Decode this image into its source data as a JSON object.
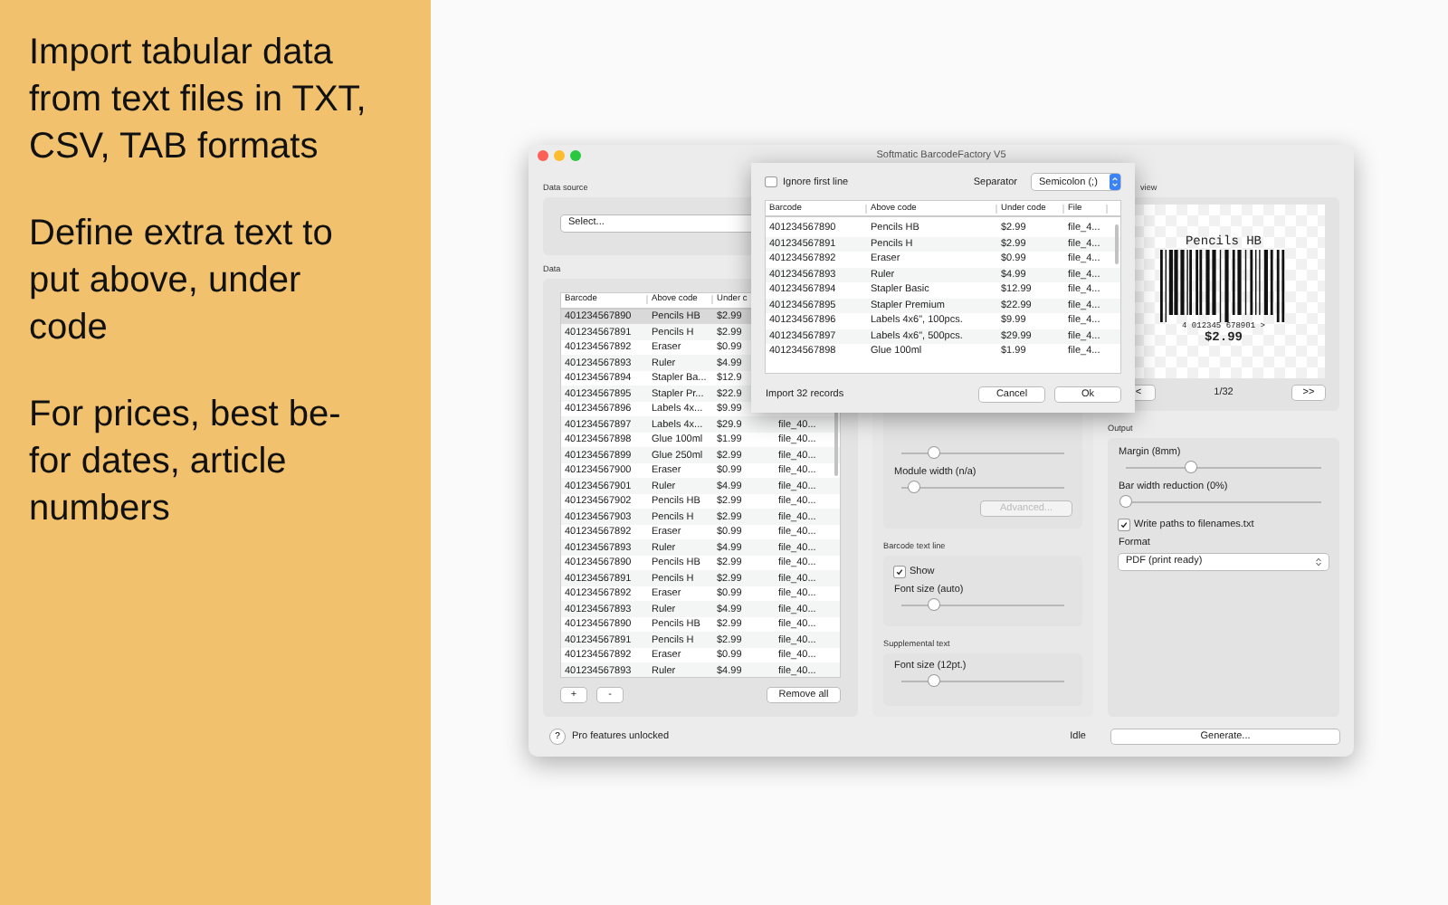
{
  "promo": {
    "paragraphs": [
      "Import tabular data from text files in TXT, CSV, TAB formats",
      "Define extra text to put above, under code",
      "For prices, best be-for dates, article numbers"
    ]
  },
  "window": {
    "title": "Softmatic BarcodeFactory V5"
  },
  "data_source": {
    "heading": "Data source",
    "select": "Select..."
  },
  "data": {
    "heading": "Data",
    "columns": [
      "Barcode",
      "Above code",
      "Under c"
    ],
    "rows": [
      {
        "barcode": "401234567890",
        "above": "Pencils HB",
        "under": "$2.99",
        "selected": true
      },
      {
        "barcode": "401234567891",
        "above": "Pencils H",
        "under": "$2.99",
        "selected": false
      },
      {
        "barcode": "401234567892",
        "above": "Eraser",
        "under": "$0.99",
        "selected": false
      },
      {
        "barcode": "401234567893",
        "above": "Ruler",
        "under": "$4.99",
        "selected": false
      },
      {
        "barcode": "401234567894",
        "above": "Stapler Ba...",
        "under": "$12.9",
        "selected": false
      },
      {
        "barcode": "401234567895",
        "above": "Stapler Pr...",
        "under": "$22.9",
        "selected": false
      },
      {
        "barcode": "401234567896",
        "above": "Labels 4x...",
        "under": "$9.99",
        "selected": false
      },
      {
        "barcode": "401234567897",
        "above": "Labels 4x...",
        "under": "$29.9",
        "file": "file_40...",
        "selected": false
      },
      {
        "barcode": "401234567898",
        "above": "Glue 100ml",
        "under": "$1.99",
        "file": "file_40...",
        "selected": false
      },
      {
        "barcode": "401234567899",
        "above": "Glue 250ml",
        "under": "$2.99",
        "file": "file_40...",
        "selected": false
      },
      {
        "barcode": "401234567900",
        "above": "Eraser",
        "under": "$0.99",
        "file": "file_40...",
        "selected": false
      },
      {
        "barcode": "401234567901",
        "above": "Ruler",
        "under": "$4.99",
        "file": "file_40...",
        "selected": false
      },
      {
        "barcode": "401234567902",
        "above": "Pencils HB",
        "under": "$2.99",
        "file": "file_40...",
        "selected": false
      },
      {
        "barcode": "401234567903",
        "above": "Pencils H",
        "under": "$2.99",
        "file": "file_40...",
        "selected": false
      },
      {
        "barcode": "401234567892",
        "above": "Eraser",
        "under": "$0.99",
        "file": "file_40...",
        "selected": false
      },
      {
        "barcode": "401234567893",
        "above": "Ruler",
        "under": "$4.99",
        "file": "file_40...",
        "selected": false
      },
      {
        "barcode": "401234567890",
        "above": "Pencils HB",
        "under": "$2.99",
        "file": "file_40...",
        "selected": false
      },
      {
        "barcode": "401234567891",
        "above": "Pencils H",
        "under": "$2.99",
        "file": "file_40...",
        "selected": false
      },
      {
        "barcode": "401234567892",
        "above": "Eraser",
        "under": "$0.99",
        "file": "file_40...",
        "selected": false
      },
      {
        "barcode": "401234567893",
        "above": "Ruler",
        "under": "$4.99",
        "file": "file_40...",
        "selected": false
      },
      {
        "barcode": "401234567890",
        "above": "Pencils HB",
        "under": "$2.99",
        "file": "file_40...",
        "selected": false
      },
      {
        "barcode": "401234567891",
        "above": "Pencils H",
        "under": "$2.99",
        "file": "file_40...",
        "selected": false
      },
      {
        "barcode": "401234567892",
        "above": "Eraser",
        "under": "$0.99",
        "file": "file_40...",
        "selected": false
      },
      {
        "barcode": "401234567893",
        "above": "Ruler",
        "under": "$4.99",
        "file": "file_40...",
        "selected": false
      }
    ],
    "add": "+",
    "remove": "-",
    "remove_all": "Remove all"
  },
  "code_settings": {
    "items": [
      {
        "kind": "slider",
        "level": 0.2
      },
      {
        "kind": "slider",
        "label": "Module width (n/a)",
        "level": 0.08
      },
      {
        "kind": "button",
        "label": "Advanced...",
        "disabled": true
      }
    ]
  },
  "text_line": {
    "heading": "Barcode text line",
    "items": [
      {
        "kind": "checkbox",
        "label": "Show",
        "checked": true
      },
      {
        "kind": "slider",
        "label": "Font size (auto)",
        "level": 0.2
      }
    ]
  },
  "supplemental": {
    "heading": "Supplemental text",
    "items": [
      {
        "kind": "slider",
        "label": "Font size (12pt.)",
        "level": 0.2
      }
    ]
  },
  "preview": {
    "heading": "view",
    "top_text": "Pencils HB",
    "digits": "4 012345 678901 >",
    "bottom_text": "$2.99",
    "prev": "<",
    "page": "1/32",
    "next": ">>"
  },
  "output": {
    "heading": "Output",
    "items": [
      {
        "kind": "slider",
        "label": "Margin (8mm)",
        "level": 0.33
      },
      {
        "kind": "slider",
        "label": "Bar width reduction (0%)",
        "level": 0
      },
      {
        "kind": "checkbox",
        "label": "Write paths to filenames.txt",
        "checked": true
      },
      {
        "kind": "select",
        "label": "Format",
        "value": "PDF (print ready)"
      }
    ]
  },
  "status": {
    "help": "?",
    "message": "Pro features unlocked",
    "state": "Idle",
    "generate": "Generate..."
  },
  "import_sheet": {
    "ignore_first_line": {
      "label": "Ignore first line",
      "checked": false
    },
    "separator_label": "Separator",
    "separator": "Semicolon (;)",
    "columns": [
      "Barcode",
      "Above code",
      "Under code",
      "File"
    ],
    "rows": [
      [
        "401234567890",
        "Pencils HB",
        "$2.99",
        "file_4..."
      ],
      [
        "401234567891",
        "Pencils H",
        "$2.99",
        "file_4..."
      ],
      [
        "401234567892",
        "Eraser",
        "$0.99",
        "file_4..."
      ],
      [
        "401234567893",
        "Ruler",
        "$4.99",
        "file_4..."
      ],
      [
        "401234567894",
        "Stapler Basic",
        "$12.99",
        "file_4..."
      ],
      [
        "401234567895",
        "Stapler Premium",
        "$22.99",
        "file_4..."
      ],
      [
        "401234567896",
        "Labels 4x6\", 100pcs.",
        "$9.99",
        "file_4..."
      ],
      [
        "401234567897",
        "Labels 4x6\", 500pcs.",
        "$29.99",
        "file_4..."
      ],
      [
        "401234567898",
        "Glue 100ml",
        "$1.99",
        "file_4..."
      ]
    ],
    "summary": "Import 32 records",
    "cancel": "Cancel",
    "ok": "Ok"
  }
}
